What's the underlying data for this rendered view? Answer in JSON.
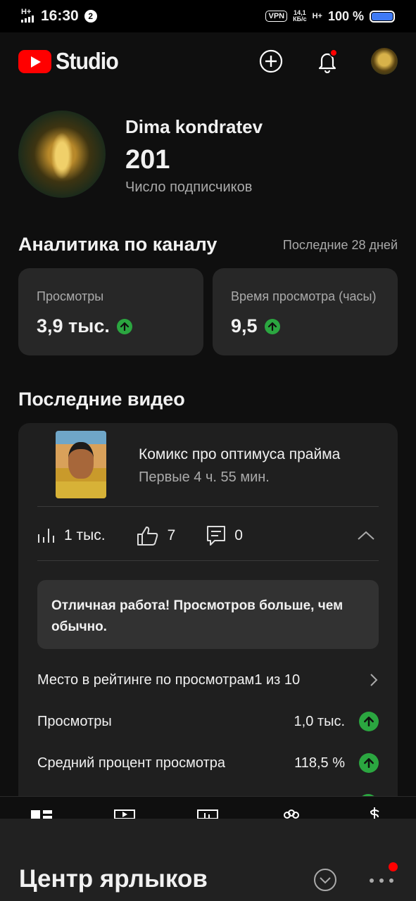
{
  "status_bar": {
    "network": "H+",
    "time": "16:30",
    "notification_count": "2",
    "vpn": "VPN",
    "speed_value": "14,1",
    "speed_unit": "КБ/с",
    "network2": "H+",
    "battery": "100 %"
  },
  "app_bar": {
    "logo_text": "Studio",
    "icons": [
      "create-icon",
      "notifications-icon",
      "account-avatar"
    ]
  },
  "profile": {
    "channel_name": "Dima kondratev",
    "subscriber_count": "201",
    "subscriber_label": "Число подписчиков"
  },
  "analytics": {
    "title": "Аналитика по каналу",
    "period": "Последние 28 дней",
    "cards": [
      {
        "label": "Просмотры",
        "value": "3,9 тыс."
      },
      {
        "label": "Время просмотра (часы)",
        "value": "9,5"
      }
    ]
  },
  "latest_videos": {
    "title": "Последние видео",
    "video": {
      "title": "Комикс про оптимуса прайма",
      "subtitle": "Первые 4 ч. 55 мин.",
      "views": "1 тыс.",
      "likes": "7",
      "comments": "0"
    },
    "notice": "Отличная работа! Просмотров больше, чем обычно.",
    "rows": [
      {
        "label": "Место в рейтинге по просмотрам",
        "value": "1 из 10"
      },
      {
        "label": "Просмотры",
        "value": "1,0 тыс."
      },
      {
        "label": "Средний процент просмотра",
        "value": "118,5 %"
      }
    ]
  },
  "bottom_nav": {
    "items": [
      "dashboard-icon",
      "content-icon",
      "analytics-icon",
      "community-icon",
      "earn-icon"
    ]
  },
  "sheet": {
    "title": "Центр ярлыков"
  },
  "colors": {
    "background": "#0f0f0f",
    "card": "#272727",
    "accent_red": "#ff0000",
    "positive_green": "#2ba640",
    "secondary_text": "#aaaaaa"
  }
}
